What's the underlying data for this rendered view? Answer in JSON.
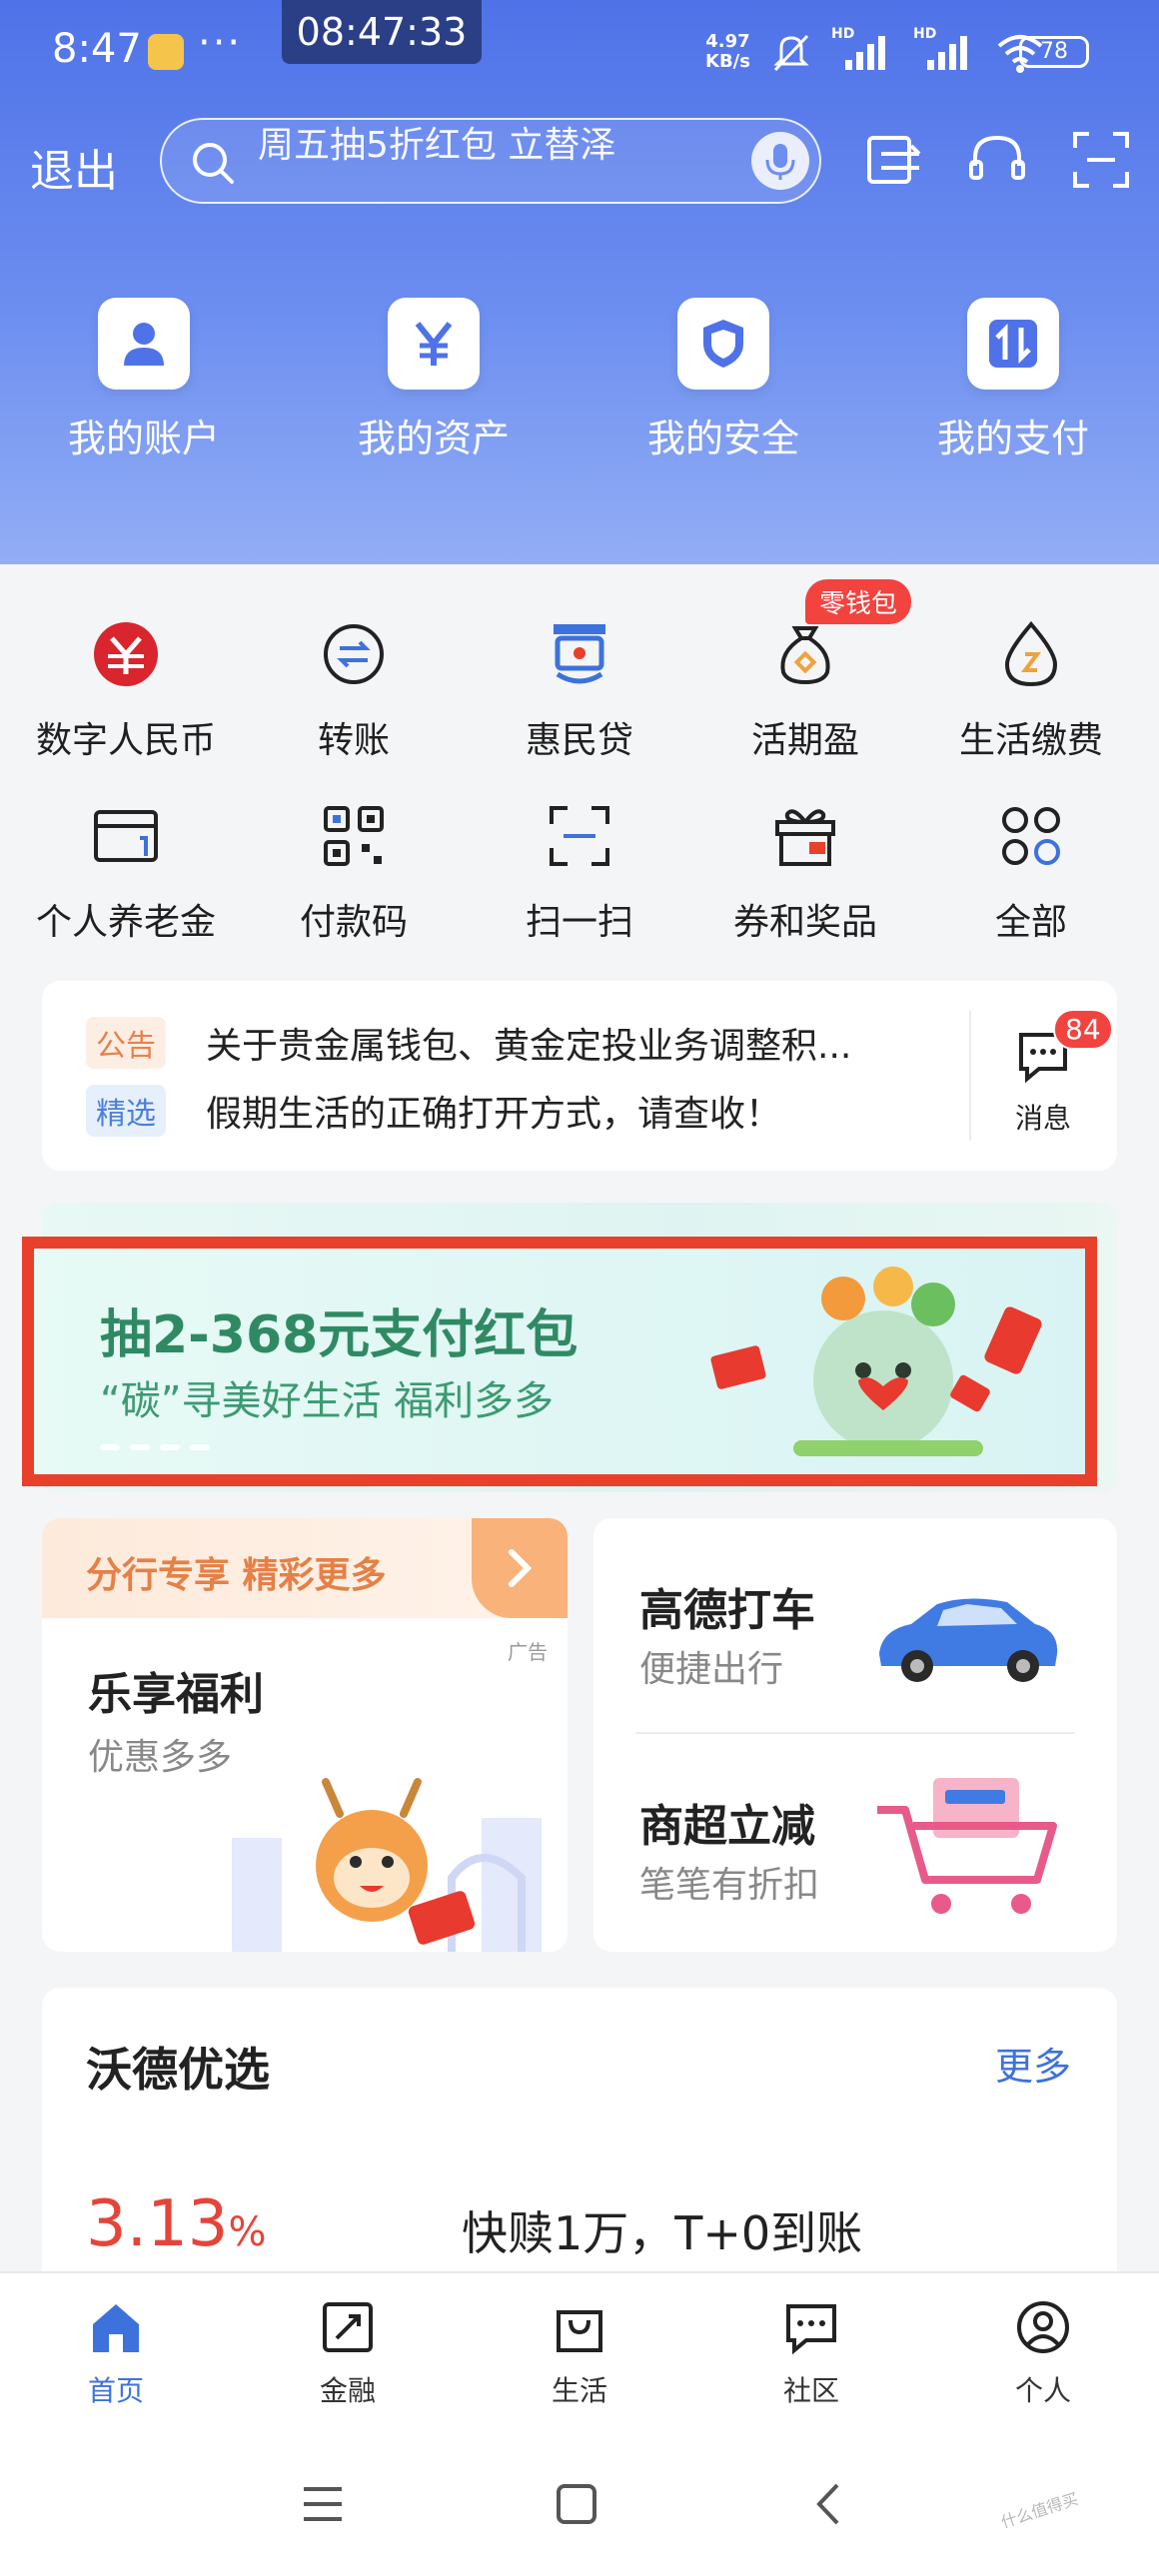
{
  "status_bar": {
    "time": "8:47",
    "clock_pill": "08:47:33",
    "more_dots": "···",
    "net_speed_value": "4.97",
    "net_speed_unit": "KB/s",
    "signal_1": "HD",
    "signal_2": "HD",
    "battery": "78"
  },
  "header": {
    "exit_label": "退出",
    "search_text": "周五抽5折红包 立替泽",
    "icons": [
      "transfer-list-icon",
      "headset-icon",
      "scan-frame-icon"
    ]
  },
  "quick_tiles": [
    {
      "label": "我的账户",
      "icon": "person-icon"
    },
    {
      "label": "我的资产",
      "icon": "yen-icon"
    },
    {
      "label": "我的安全",
      "icon": "shield-icon"
    },
    {
      "label": "我的支付",
      "icon": "up-down-arrows-icon"
    }
  ],
  "grid_menu": [
    {
      "label": "数字人民币",
      "icon": "digital-rmb-icon"
    },
    {
      "label": "转账",
      "icon": "transfer-icon"
    },
    {
      "label": "惠民贷",
      "icon": "loan-icon"
    },
    {
      "label": "活期盈",
      "icon": "money-bag-icon"
    },
    {
      "label": "生活缴费",
      "icon": "water-drop-icon"
    },
    {
      "label": "个人养老金",
      "icon": "pension-card-icon"
    },
    {
      "label": "付款码",
      "icon": "qr-code-icon"
    },
    {
      "label": "扫一扫",
      "icon": "scan-icon"
    },
    {
      "label": "券和奖品",
      "icon": "gift-icon"
    },
    {
      "label": "全部",
      "icon": "all-apps-icon"
    }
  ],
  "wallet_badge": "零钱包",
  "notice": {
    "tag_announcement": "公告",
    "tag_selected": "精选",
    "line_1": "关于贵金属钱包、黄金定投业务调整积...",
    "line_2": "假期生活的正确打开方式，请查收！",
    "message_label": "消息",
    "message_count": "84"
  },
  "banner": {
    "title": "抽2-368元支付红包",
    "subtitle": "“碳”寻美好生活 福利多多"
  },
  "promo_left": {
    "header": "分行专享 精彩更多",
    "ad_tag": "广告",
    "title": "乐享福利",
    "subtitle": "优惠多多"
  },
  "promo_right": {
    "item_1_title": "高德打车",
    "item_1_sub": "便捷出行",
    "item_2_title": "商超立减",
    "item_2_sub": "笔笔有折扣"
  },
  "picks": {
    "title": "沃德优选",
    "more": "更多",
    "rate_value": "3.13",
    "rate_unit": "%",
    "desc": "快赎1万，T+0到账"
  },
  "tabbar": [
    {
      "label": "首页",
      "icon": "home-icon",
      "active": true
    },
    {
      "label": "金融",
      "icon": "finance-icon",
      "active": false
    },
    {
      "label": "生活",
      "icon": "shopping-bag-icon",
      "active": false
    },
    {
      "label": "社区",
      "icon": "chat-icon",
      "active": false
    },
    {
      "label": "个人",
      "icon": "profile-icon",
      "active": false
    }
  ],
  "watermark": "什么值得买",
  "colors": {
    "brand_blue": "#3d72dc",
    "badge_red": "#f2433f",
    "banner_green": "#2f8a64",
    "highlight_frame": "#e9402c"
  }
}
